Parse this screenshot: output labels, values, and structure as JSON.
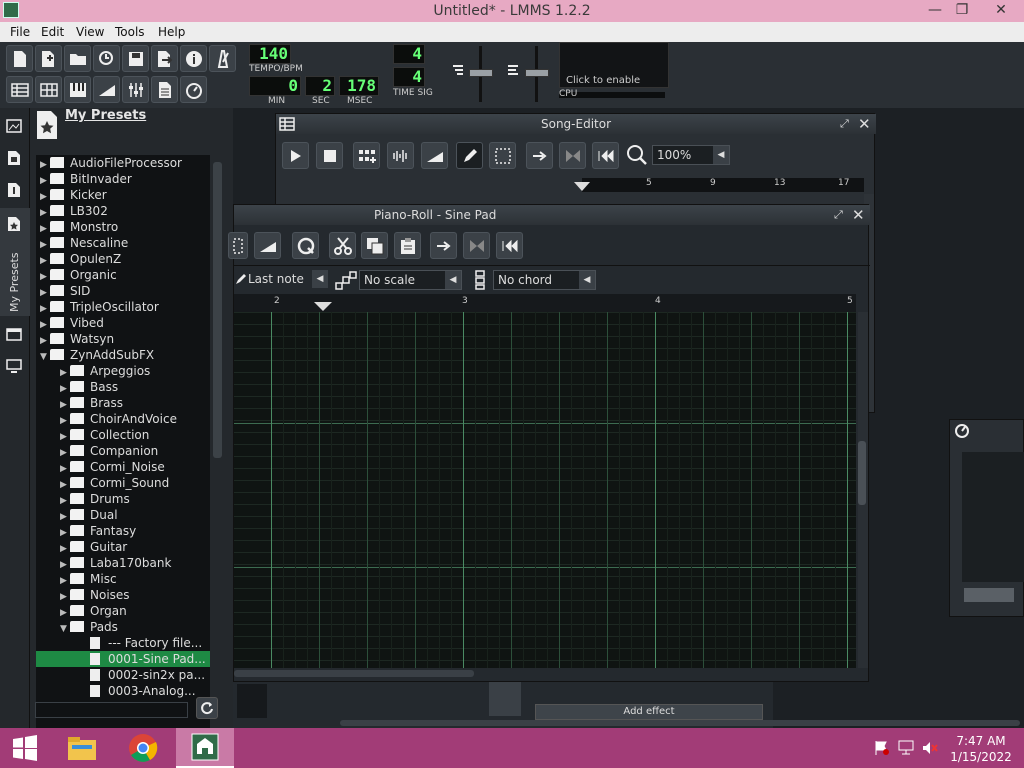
{
  "window": {
    "title": "Untitled* - LMMS 1.2.2"
  },
  "menu": {
    "items": [
      "File",
      "Edit",
      "View",
      "Tools",
      "Help"
    ]
  },
  "transport": {
    "tempo": "140",
    "tempo_label": "TEMPO/BPM",
    "min": "0",
    "min_label": "MIN",
    "sec": "2",
    "sec_label": "SEC",
    "msec": "178",
    "msec_label": "MSEC",
    "timesig_num": "4",
    "timesig_den": "4",
    "timesig_label": "TIME SIG",
    "cpu_hint": "Click to enable",
    "cpu_label": "CPU"
  },
  "sidebar": {
    "vertical_tab": "My Presets"
  },
  "browser": {
    "title": "My Presets",
    "items": [
      {
        "label": "AudioFileProcessor",
        "depth": 0,
        "expanded": false,
        "type": "folder"
      },
      {
        "label": "BitInvader",
        "depth": 0,
        "expanded": false,
        "type": "folder"
      },
      {
        "label": "Kicker",
        "depth": 0,
        "expanded": false,
        "type": "folder"
      },
      {
        "label": "LB302",
        "depth": 0,
        "expanded": false,
        "type": "folder"
      },
      {
        "label": "Monstro",
        "depth": 0,
        "expanded": false,
        "type": "folder"
      },
      {
        "label": "Nescaline",
        "depth": 0,
        "expanded": false,
        "type": "folder"
      },
      {
        "label": "OpulenZ",
        "depth": 0,
        "expanded": false,
        "type": "folder"
      },
      {
        "label": "Organic",
        "depth": 0,
        "expanded": false,
        "type": "folder"
      },
      {
        "label": "SID",
        "depth": 0,
        "expanded": false,
        "type": "folder"
      },
      {
        "label": "TripleOscillator",
        "depth": 0,
        "expanded": false,
        "type": "folder"
      },
      {
        "label": "Vibed",
        "depth": 0,
        "expanded": false,
        "type": "folder"
      },
      {
        "label": "Watsyn",
        "depth": 0,
        "expanded": false,
        "type": "folder"
      },
      {
        "label": "ZynAddSubFX",
        "depth": 0,
        "expanded": true,
        "type": "folder"
      },
      {
        "label": "Arpeggios",
        "depth": 1,
        "expanded": false,
        "type": "folder"
      },
      {
        "label": "Bass",
        "depth": 1,
        "expanded": false,
        "type": "folder"
      },
      {
        "label": "Brass",
        "depth": 1,
        "expanded": false,
        "type": "folder"
      },
      {
        "label": "ChoirAndVoice",
        "depth": 1,
        "expanded": false,
        "type": "folder"
      },
      {
        "label": "Collection",
        "depth": 1,
        "expanded": false,
        "type": "folder"
      },
      {
        "label": "Companion",
        "depth": 1,
        "expanded": false,
        "type": "folder"
      },
      {
        "label": "Cormi_Noise",
        "depth": 1,
        "expanded": false,
        "type": "folder"
      },
      {
        "label": "Cormi_Sound",
        "depth": 1,
        "expanded": false,
        "type": "folder"
      },
      {
        "label": "Drums",
        "depth": 1,
        "expanded": false,
        "type": "folder"
      },
      {
        "label": "Dual",
        "depth": 1,
        "expanded": false,
        "type": "folder"
      },
      {
        "label": "Fantasy",
        "depth": 1,
        "expanded": false,
        "type": "folder"
      },
      {
        "label": "Guitar",
        "depth": 1,
        "expanded": false,
        "type": "folder"
      },
      {
        "label": "Laba170bank",
        "depth": 1,
        "expanded": false,
        "type": "folder"
      },
      {
        "label": "Misc",
        "depth": 1,
        "expanded": false,
        "type": "folder"
      },
      {
        "label": "Noises",
        "depth": 1,
        "expanded": false,
        "type": "folder"
      },
      {
        "label": "Organ",
        "depth": 1,
        "expanded": false,
        "type": "folder"
      },
      {
        "label": "Pads",
        "depth": 1,
        "expanded": true,
        "type": "folder"
      },
      {
        "label": "--- Factory file...",
        "depth": 2,
        "expanded": false,
        "type": "preset"
      },
      {
        "label": "0001-Sine Pad...",
        "depth": 2,
        "expanded": false,
        "type": "preset",
        "selected": true
      },
      {
        "label": "0002-sin2x pa...",
        "depth": 2,
        "expanded": false,
        "type": "preset"
      },
      {
        "label": "0003-Analog...",
        "depth": 2,
        "expanded": false,
        "type": "preset"
      }
    ]
  },
  "song_editor": {
    "title": "Song-Editor",
    "zoom": "100%",
    "bar_labels": [
      "5",
      "9",
      "13",
      "17"
    ]
  },
  "piano_roll": {
    "title": "Piano-Roll - Sine Pad",
    "note_length": "Last note",
    "scale": "No scale",
    "chord": "No chord",
    "bar_labels": [
      "2",
      "3",
      "4",
      "5"
    ]
  },
  "fx": {
    "add_effect": "Add effect"
  },
  "clock": {
    "time": "7:47 AM",
    "date": "1/15/2022"
  },
  "colors": {
    "accent_green": "#66ff77",
    "taskbar": "#a23c77",
    "titlebar": "#e7a9c3",
    "selection": "#1e8a44"
  }
}
